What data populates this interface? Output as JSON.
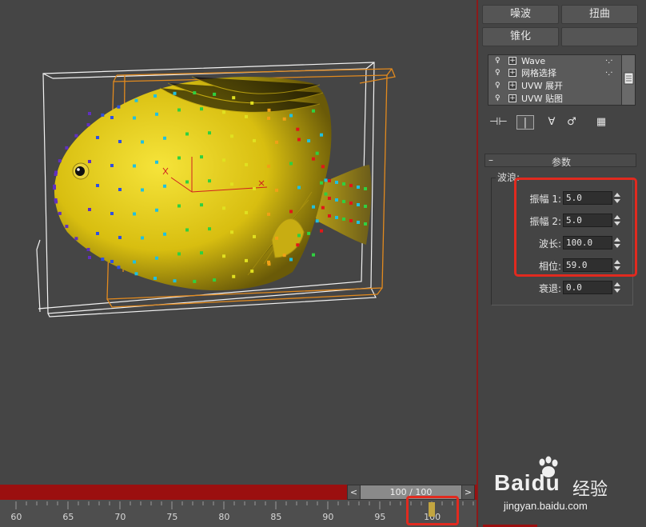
{
  "panel": {
    "buttons": [
      "噪波",
      "扭曲",
      "锥化",
      ""
    ],
    "stack": [
      {
        "label": "Wave",
        "dots": "·.·"
      },
      {
        "label": "网格选择",
        "dots": "·.·"
      },
      {
        "label": "UVW 展开",
        "dots": ""
      },
      {
        "label": "UVW 贴图",
        "dots": ""
      }
    ],
    "tools": [
      "⊣⊢",
      "|",
      "∀",
      "♂",
      "▦"
    ],
    "rollout_title": "参数",
    "rollout_minus": "–",
    "group_title": "波浪:",
    "params": [
      {
        "label": "振幅 1:",
        "value": "5.0"
      },
      {
        "label": "振幅 2:",
        "value": "5.0"
      },
      {
        "label": "波长:",
        "value": "100.0"
      },
      {
        "label": "相位:",
        "value": "59.0"
      },
      {
        "label": "衰退:",
        "value": "0.0"
      }
    ]
  },
  "timeline": {
    "readout": "100 / 100",
    "prev_label": "<",
    "next_label": ">",
    "ticks": [
      "60",
      "65",
      "70",
      "75",
      "80",
      "85",
      "90",
      "95",
      "100"
    ],
    "current_frame": 100
  },
  "watermark": {
    "brand": "Bai",
    "brand2": "du",
    "jingyan": "经验",
    "url": "jingyan.baidu.com"
  },
  "colors": {
    "highlight": "#e12a1f",
    "timebar": "#9b0f0f",
    "fish_body": "#e8cc1a"
  }
}
